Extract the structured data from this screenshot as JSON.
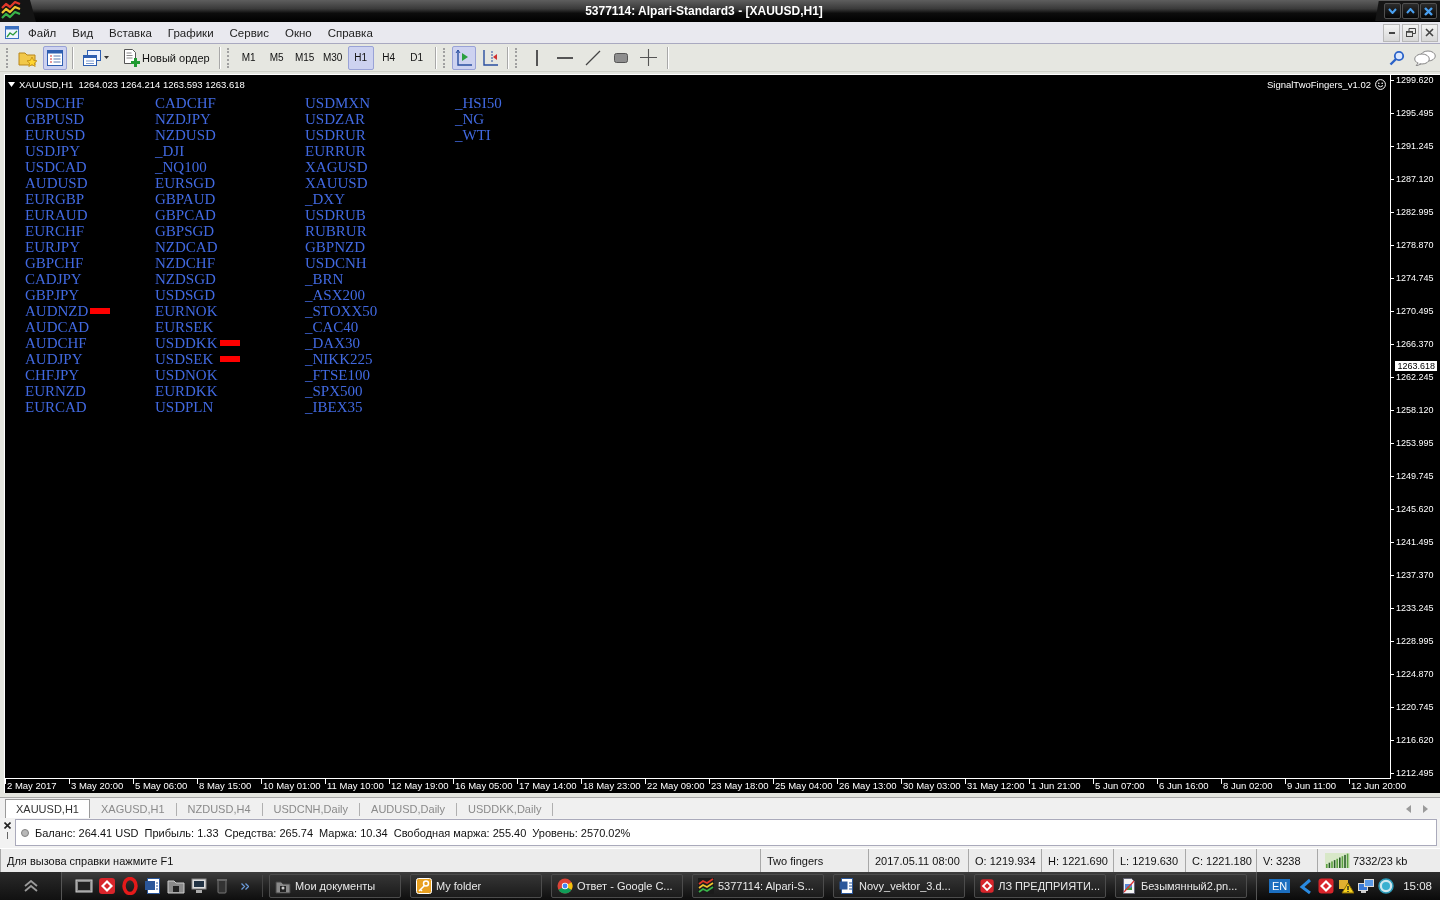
{
  "window": {
    "title": "5377114: Alpari-Standard3 - [XAUUSD,H1]"
  },
  "menu": [
    "Файл",
    "Вид",
    "Вставка",
    "Графики",
    "Сервис",
    "Окно",
    "Справка"
  ],
  "toolbar": {
    "tools": [
      {
        "kind": "favorites",
        "on": false
      },
      {
        "kind": "navigator",
        "on": true
      },
      {
        "kind": "profiles",
        "on": false
      }
    ],
    "new_order": "Новый ордер",
    "timeframes": [
      {
        "label": "M1",
        "selected": false
      },
      {
        "label": "M5",
        "selected": false
      },
      {
        "label": "M15",
        "selected": false
      },
      {
        "label": "M30",
        "selected": false
      },
      {
        "label": "H1",
        "selected": true
      },
      {
        "label": "H4",
        "selected": false
      },
      {
        "label": "D1",
        "selected": false
      }
    ],
    "chart_tools": [
      {
        "kind": "autoscroll",
        "on": true
      },
      {
        "kind": "shift",
        "on": false
      }
    ],
    "drawing_tools": [
      {
        "kind": "vline"
      },
      {
        "kind": "hline"
      },
      {
        "kind": "trendline"
      },
      {
        "kind": "rectangle"
      },
      {
        "kind": "crosshair"
      }
    ]
  },
  "chart": {
    "symbol": "XAUUSD,H1",
    "prices": "1264.023 1264.214 1263.593 1263.618",
    "indicator": "SignalTwoFingers_v1.02",
    "symbol_columns": [
      [
        {
          "name": "USDCHF",
          "signal": false
        },
        {
          "name": "GBPUSD",
          "signal": false
        },
        {
          "name": "EURUSD",
          "signal": false
        },
        {
          "name": "USDJPY",
          "signal": false
        },
        {
          "name": "USDCAD",
          "signal": false
        },
        {
          "name": "AUDUSD",
          "signal": false
        },
        {
          "name": "EURGBP",
          "signal": false
        },
        {
          "name": "EURAUD",
          "signal": false
        },
        {
          "name": "EURCHF",
          "signal": false
        },
        {
          "name": "EURJPY",
          "signal": false
        },
        {
          "name": "GBPCHF",
          "signal": false
        },
        {
          "name": "CADJPY",
          "signal": false
        },
        {
          "name": "GBPJPY",
          "signal": false
        },
        {
          "name": "AUDNZD",
          "signal": true
        },
        {
          "name": "AUDCAD",
          "signal": false
        },
        {
          "name": "AUDCHF",
          "signal": false
        },
        {
          "name": "AUDJPY",
          "signal": false
        },
        {
          "name": "CHFJPY",
          "signal": false
        },
        {
          "name": "EURNZD",
          "signal": false
        },
        {
          "name": "EURCAD",
          "signal": false
        }
      ],
      [
        {
          "name": "CADCHF",
          "signal": false
        },
        {
          "name": "NZDJPY",
          "signal": false
        },
        {
          "name": "NZDUSD",
          "signal": false
        },
        {
          "name": "_DJI",
          "signal": false
        },
        {
          "name": "_NQ100",
          "signal": false
        },
        {
          "name": "EURSGD",
          "signal": false
        },
        {
          "name": "GBPAUD",
          "signal": false
        },
        {
          "name": "GBPCAD",
          "signal": false
        },
        {
          "name": "GBPSGD",
          "signal": false
        },
        {
          "name": "NZDCAD",
          "signal": false
        },
        {
          "name": "NZDCHF",
          "signal": false
        },
        {
          "name": "NZDSGD",
          "signal": false
        },
        {
          "name": "USDSGD",
          "signal": false
        },
        {
          "name": "EURNOK",
          "signal": false
        },
        {
          "name": "EURSEK",
          "signal": false
        },
        {
          "name": "USDDKK",
          "signal": true
        },
        {
          "name": "USDSEK",
          "signal": true
        },
        {
          "name": "USDNOK",
          "signal": false
        },
        {
          "name": "EURDKK",
          "signal": false
        },
        {
          "name": "USDPLN",
          "signal": false
        }
      ],
      [
        {
          "name": "USDMXN",
          "signal": false
        },
        {
          "name": "USDZAR",
          "signal": false
        },
        {
          "name": "USDRUR",
          "signal": false
        },
        {
          "name": "EURRUR",
          "signal": false
        },
        {
          "name": "XAGUSD",
          "signal": false
        },
        {
          "name": "XAUUSD",
          "signal": false
        },
        {
          "name": "_DXY",
          "signal": false
        },
        {
          "name": "USDRUB",
          "signal": false
        },
        {
          "name": "RUBRUR",
          "signal": false
        },
        {
          "name": "GBPNZD",
          "signal": false
        },
        {
          "name": "USDCNH",
          "signal": false
        },
        {
          "name": "_BRN",
          "signal": false
        },
        {
          "name": "_ASX200",
          "signal": false
        },
        {
          "name": "_STOXX50",
          "signal": false
        },
        {
          "name": "_CAC40",
          "signal": false
        },
        {
          "name": "_DAX30",
          "signal": false
        },
        {
          "name": "_NIKK225",
          "signal": false
        },
        {
          "name": "_FTSE100",
          "signal": false
        },
        {
          "name": "_SPX500",
          "signal": false
        },
        {
          "name": "_IBEX35",
          "signal": false
        }
      ],
      [
        {
          "name": "_HSI50",
          "signal": false
        },
        {
          "name": "_NG",
          "signal": false
        },
        {
          "name": "_WTI",
          "signal": false
        }
      ]
    ],
    "price_labels": [
      "1299.620",
      "1295.495",
      "1291.245",
      "1287.120",
      "1282.995",
      "1278.870",
      "1274.745",
      "1270.495",
      "1266.370",
      "1262.245",
      "1258.120",
      "1253.995",
      "1249.745",
      "1245.620",
      "1241.495",
      "1237.370",
      "1233.245",
      "1228.995",
      "1224.870",
      "1220.745",
      "1216.620",
      "1212.495"
    ],
    "current_price": "1263.618",
    "time_labels": [
      "2 May 2017",
      "3 May 20:00",
      "5 May 06:00",
      "8 May 15:00",
      "10 May 01:00",
      "11 May 10:00",
      "12 May 19:00",
      "16 May 05:00",
      "17 May 14:00",
      "18 May 23:00",
      "22 May 09:00",
      "23 May 18:00",
      "25 May 04:00",
      "26 May 13:00",
      "30 May 03:00",
      "31 May 12:00",
      "1 Jun 21:00",
      "5 Jun 07:00",
      "6 Jun 16:00",
      "8 Jun 02:00",
      "9 Jun 11:00",
      "12 Jun 20:00"
    ]
  },
  "chart_tabs": [
    {
      "label": "XAUUSD,H1",
      "selected": true
    },
    {
      "label": "XAGUSD,H1",
      "selected": false
    },
    {
      "label": "NZDUSD,H4",
      "selected": false
    },
    {
      "label": "USDCNH,Daily",
      "selected": false
    },
    {
      "label": "AUDUSD,Daily",
      "selected": false
    },
    {
      "label": "USDDKK,Daily",
      "selected": false
    }
  ],
  "account": [
    "Баланс: 264.41 USD",
    "Прибыль: 1.33",
    "Средства: 265.74",
    "Маржа: 10.34",
    "Свободная маржа: 255.40",
    "Уровень: 2570.02%"
  ],
  "status_bar": {
    "help": "Для вызова справки нажмите F1",
    "profile": "Two fingers",
    "time": "2017.05.11 08:00",
    "open": "O: 1219.934",
    "high": "H: 1221.690",
    "low": "L: 1219.630",
    "close": "C: 1221.180",
    "volume": "V: 3238",
    "traffic": "7332/23 kb"
  },
  "taskbar": {
    "tasks": [
      {
        "kind": "folder",
        "label": "Мои документы"
      },
      {
        "kind": "keyfolder",
        "label": "My folder"
      },
      {
        "kind": "browser",
        "label": "Ответ - Google C..."
      },
      {
        "kind": "terminal",
        "label": "5377114: Alpari-S..."
      },
      {
        "kind": "document",
        "label": "Novy_vektor_3.d..."
      },
      {
        "kind": "app",
        "label": "ЛЗ ПРЕДПРИЯТИ..."
      },
      {
        "kind": "image",
        "label": "Безымянный2.pn..."
      }
    ],
    "language": "EN",
    "clock": "15:08"
  }
}
